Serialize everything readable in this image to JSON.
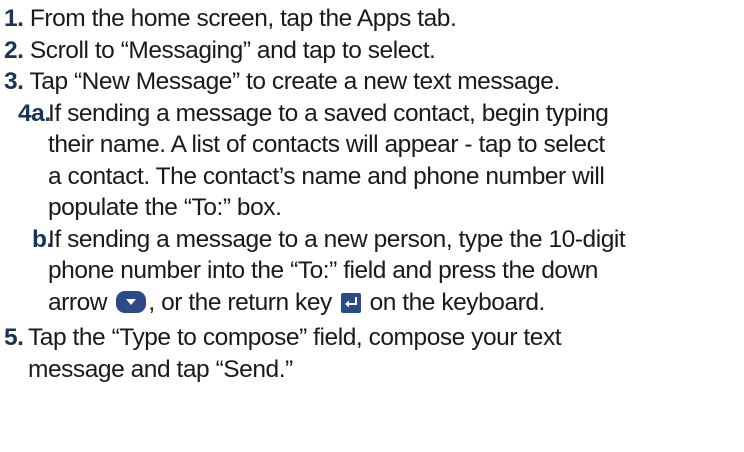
{
  "steps": [
    {
      "number": "1.",
      "lines": [
        "From the home screen, tap the Apps tab."
      ]
    },
    {
      "number": "2.",
      "lines": [
        "Scroll to “Messaging” and tap to select."
      ]
    },
    {
      "number": "3.",
      "lines": [
        "Tap “New Message” to create a new text message."
      ]
    },
    {
      "number": "4a.",
      "lines": [
        "If sending a message to a saved contact, begin typing",
        "their name. A list of contacts will appear - tap to select",
        "a contact. The contact’s name and phone number will",
        "populate the “To:” box."
      ]
    },
    {
      "number": "b.",
      "lines": [
        "If sending a message to a new person, type the 10-digit",
        "phone number into the “To:” field and press the down"
      ],
      "last_line": {
        "before": "arrow",
        "icon1": "down-arrow-key-icon",
        "middle": ", or the return key",
        "icon2": "return-key-icon",
        "after": "on the keyboard."
      }
    },
    {
      "number": "5.",
      "lines": [
        "Tap the “Type to compose” field, compose your text",
        "message and tap “Send.”"
      ]
    }
  ],
  "colors": {
    "number": "#1a3358",
    "text": "#1a1a1a",
    "icon_fill": "#2c4a86"
  }
}
